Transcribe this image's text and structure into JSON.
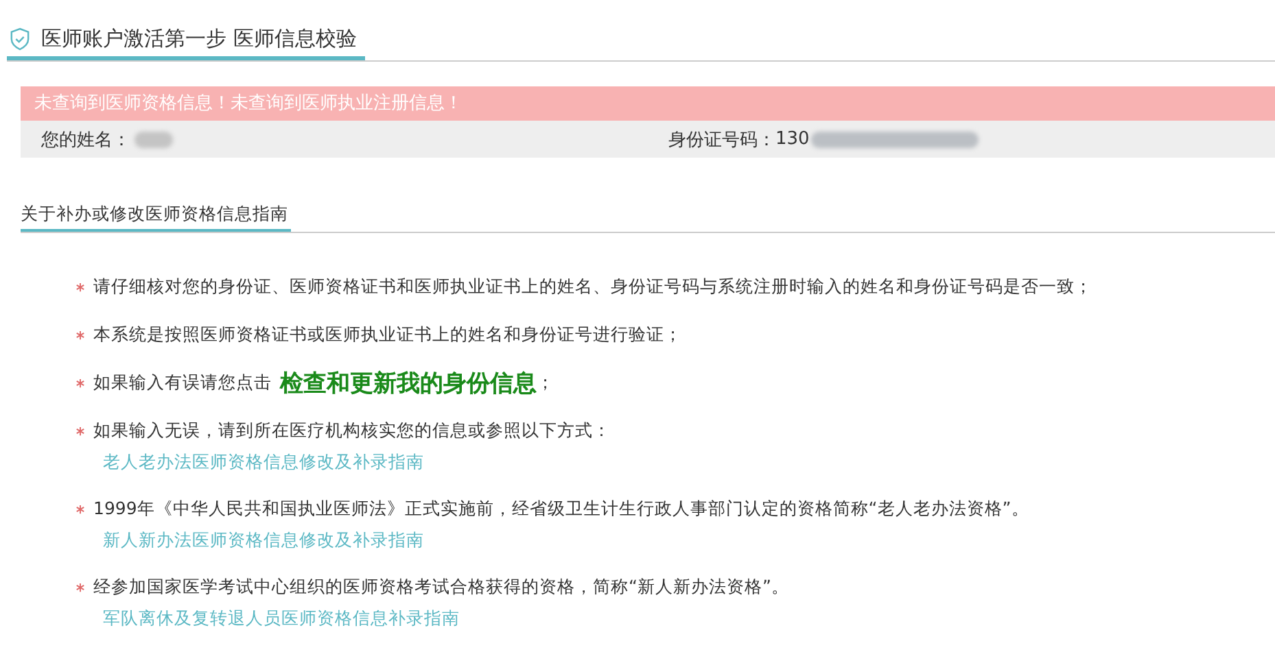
{
  "page_title": "医师账户激活第一步 医师信息校验",
  "alert": "未查询到医师资格信息！未查询到医师执业注册信息！",
  "identity": {
    "name_label": "您的姓名：",
    "name_redacted": true,
    "id_label": "身份证号码：",
    "id_value": "130",
    "id_redacted": true
  },
  "section_title": "关于补办或修改医师资格信息指南",
  "items": [
    {
      "kind": "note",
      "text": "请仔细核对您的身份证、医师资格证书和医师执业证书上的姓名、身份证号码与系统注册时输入的姓名和身份证号码是否一致；"
    },
    {
      "kind": "note",
      "text": "本系统是按照医师资格证书或医师执业证书上的姓名和身份证号进行验证；"
    },
    {
      "kind": "action",
      "text": "如果输入有误请您点击",
      "action": "检查和更新我的身份信息",
      "after": "；"
    },
    {
      "kind": "note",
      "text": "如果输入无误，请到所在医疗机构核实您的信息或参照以下方式："
    },
    {
      "kind": "guide_link",
      "text": "老人老办法医师资格信息修改及补录指南"
    },
    {
      "kind": "note",
      "text": "1999年《中华人民共和国执业医师法》正式实施前，经省级卫生计生行政人事部门认定的资格简称“老人老办法资格”。"
    },
    {
      "kind": "guide_link",
      "text": "新人新办法医师资格信息修改及补录指南"
    },
    {
      "kind": "note",
      "text": "经参加国家医学考试中心组织的医师资格考试合格获得的资格，简称“新人新办法资格”。"
    },
    {
      "kind": "guide_link",
      "text": "军队离休及复转退人员医师资格信息补录指南"
    }
  ]
}
